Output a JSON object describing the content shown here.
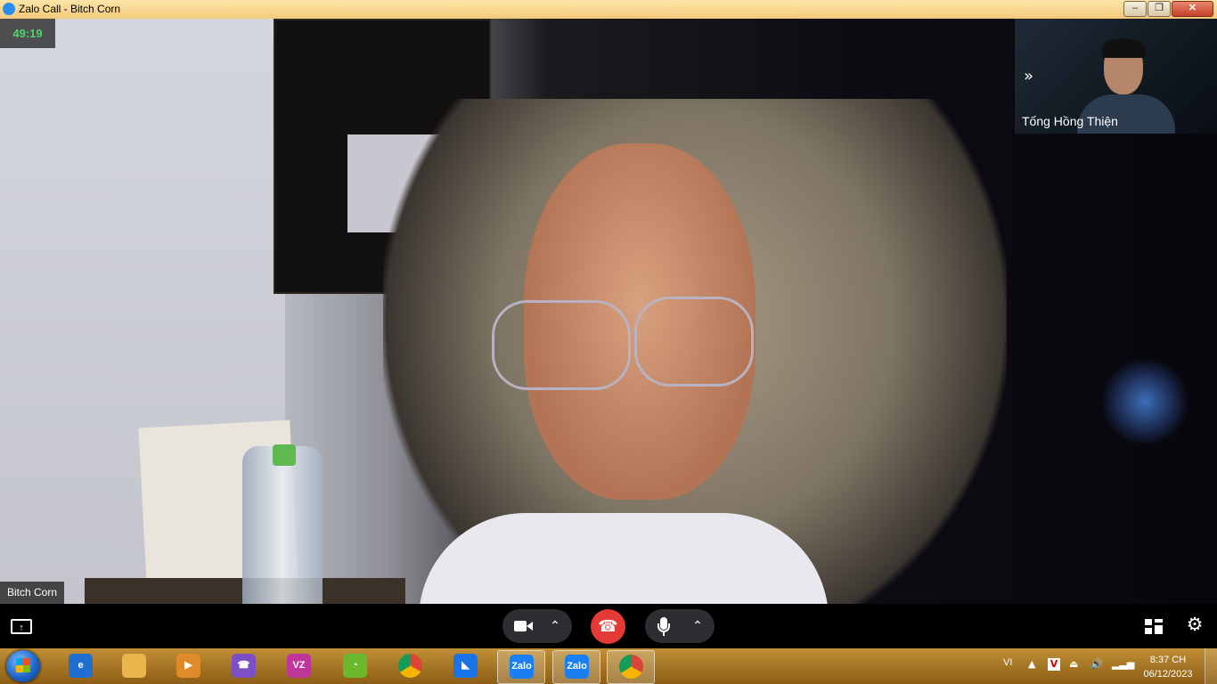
{
  "window": {
    "title": "Zalo Call - Bitch Corn",
    "minimize": "–",
    "restore": "❐",
    "close": "✕"
  },
  "call": {
    "timer": "49:19",
    "remote_name": "Bitch Corn",
    "self_name": "Tống Hồng Thiện",
    "pip_toggle": "»"
  },
  "controls": {
    "camera_options": "⌃",
    "mic_options": "⌃",
    "hangup": "☎",
    "settings": "⚙",
    "share_arrow": "↑"
  },
  "taskbar": {
    "apps": [
      {
        "name": "internet-explorer",
        "glyph": "e",
        "color": "#1f6fd1"
      },
      {
        "name": "file-explorer",
        "glyph": "",
        "color": "#e8b64a"
      },
      {
        "name": "media-player",
        "glyph": "▶",
        "color": "#e08a2a"
      },
      {
        "name": "viber",
        "glyph": "☎",
        "color": "#7d4fc4"
      },
      {
        "name": "vz-app",
        "glyph": "VZ",
        "color": "#c0359a"
      },
      {
        "name": "coc-coc",
        "glyph": "◔",
        "color": "#6bb82d"
      },
      {
        "name": "chrome",
        "glyph": "",
        "color": "#db4437"
      },
      {
        "name": "generic-app",
        "glyph": "◣",
        "color": "#1a73e8"
      },
      {
        "name": "zalo",
        "glyph": "Zalo",
        "color": "#1a7ff0"
      },
      {
        "name": "zalo-call",
        "glyph": "Zalo",
        "color": "#1a7ff0"
      },
      {
        "name": "chrome-profile",
        "glyph": "",
        "color": "#db4437"
      }
    ],
    "language": "VI",
    "time": "8:37 CH",
    "date": "06/12/2023"
  }
}
